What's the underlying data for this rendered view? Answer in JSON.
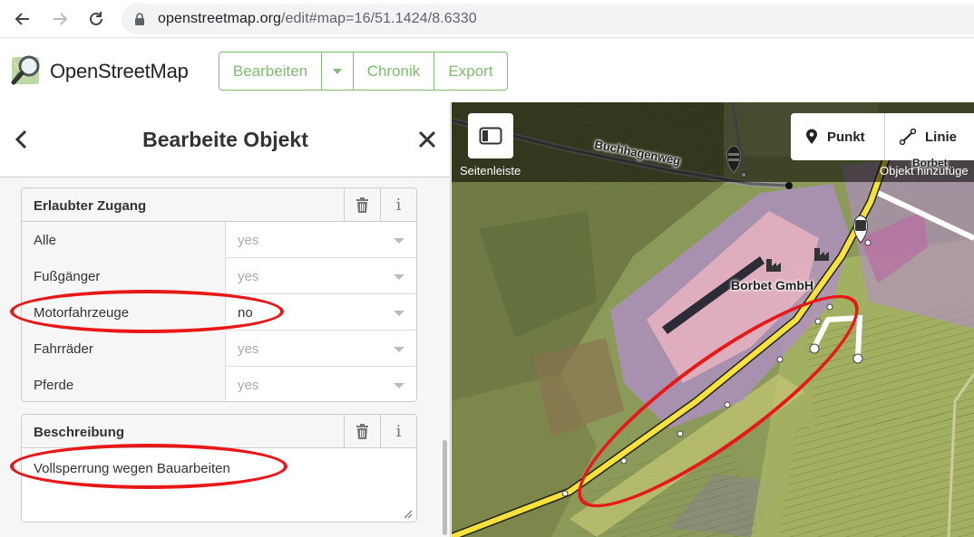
{
  "browser": {
    "url_host": "openstreetmap.org",
    "url_path": "/edit#map=16/51.1424/8.6330"
  },
  "header": {
    "brand": "OpenStreetMap",
    "edit_label": "Bearbeiten",
    "history_label": "Chronik",
    "export_label": "Export"
  },
  "panel": {
    "title": "Bearbeite Objekt"
  },
  "access_field": {
    "label": "Erlaubter Zugang",
    "rows": [
      {
        "key": "Alle",
        "value": "yes",
        "is_set": false
      },
      {
        "key": "Fußgänger",
        "value": "yes",
        "is_set": false
      },
      {
        "key": "Motorfahrzeuge",
        "value": "no",
        "is_set": true
      },
      {
        "key": "Fahrräder",
        "value": "yes",
        "is_set": false
      },
      {
        "key": "Pferde",
        "value": "yes",
        "is_set": false
      }
    ]
  },
  "description_field": {
    "label": "Beschreibung",
    "value": "Vollsperrung wegen Bauarbeiten"
  },
  "map": {
    "sidebar_toggle_label": "Seitenleiste",
    "add_point_label": "Punkt",
    "add_line_label": "Linie",
    "add_feature_label": "Objekt hinzufüge",
    "road_name": "Buchhagenweg",
    "company_name": "Borbet GmbH",
    "company_name_short": "Borbet"
  },
  "colors": {
    "osm_green": "#7ebc6f",
    "annotation_red": "#e81818",
    "road_yellow": "#f7e23c"
  }
}
